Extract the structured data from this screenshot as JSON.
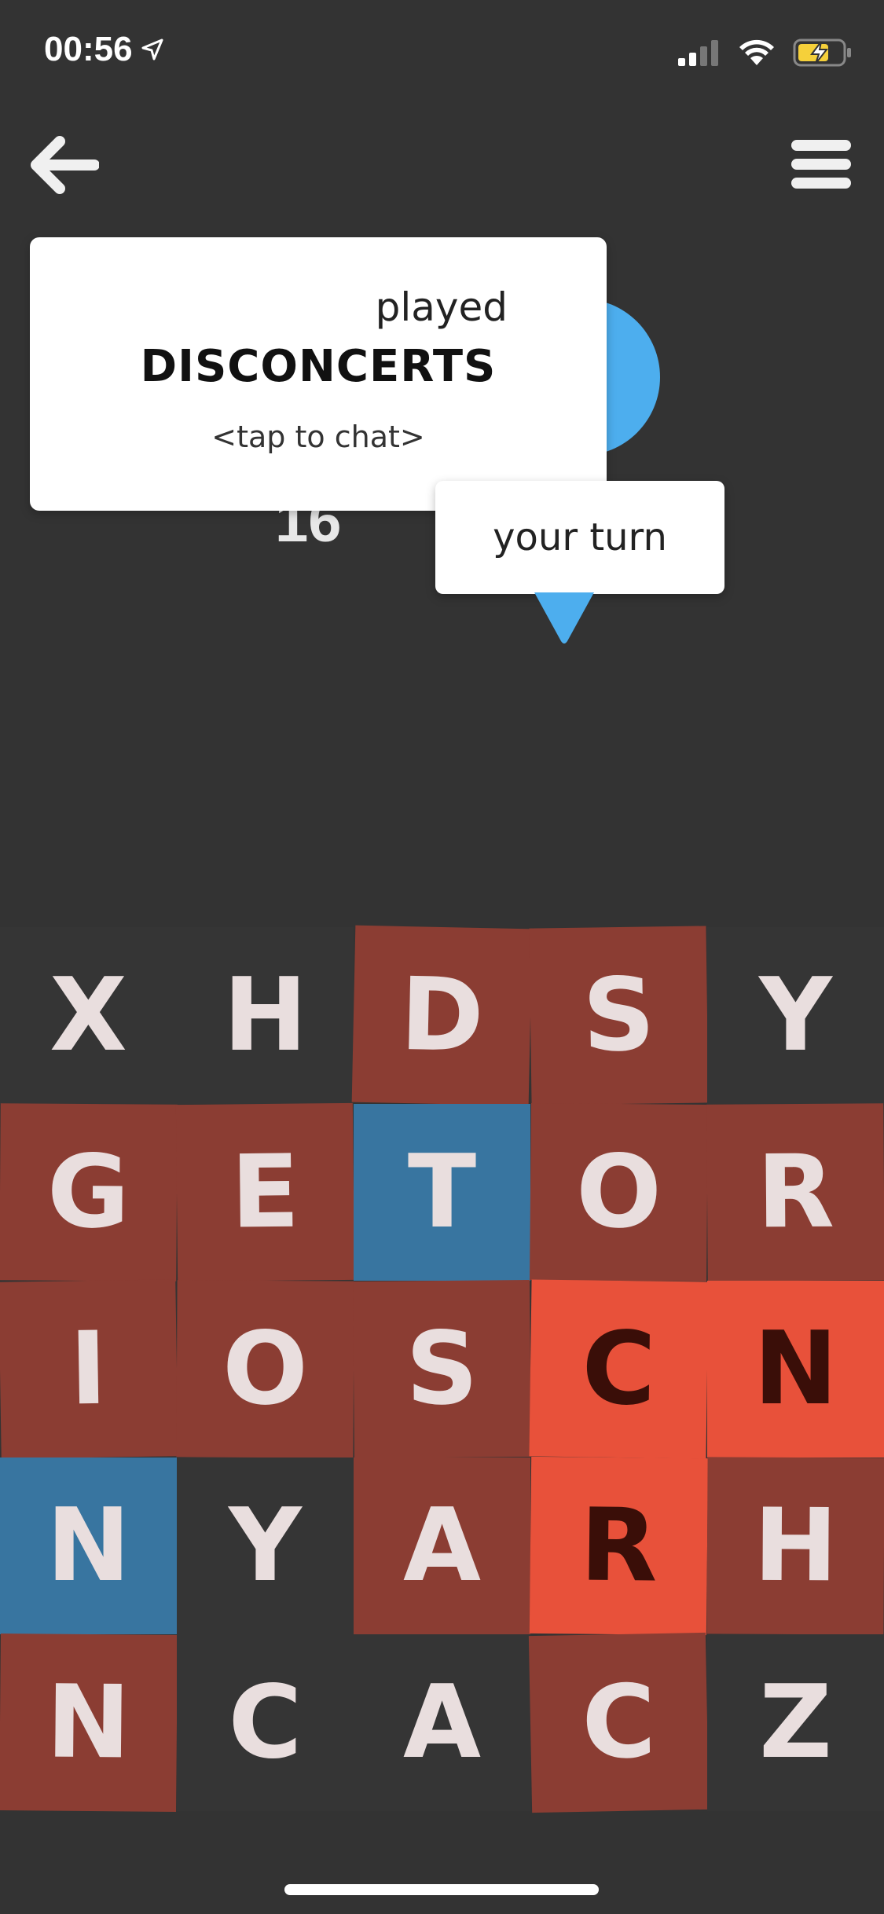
{
  "status_bar": {
    "time": "00:56",
    "location_icon": "location-arrow-icon",
    "signal_icon": "cellular-signal-icon",
    "wifi_icon": "wifi-icon",
    "battery_icon": "battery-charging-icon"
  },
  "nav": {
    "back_icon": "back-arrow-icon",
    "menu_icon": "hamburger-menu-icon"
  },
  "popup": {
    "played_label": "played",
    "word": "DISCONCERTS",
    "chat_hint": "<tap to chat>"
  },
  "score": "16",
  "turn": {
    "label": "your turn"
  },
  "colors": {
    "background": "#333333",
    "neutral_tile": "#353535",
    "red_dark": "#8B3D33",
    "red_bright": "#E8513A",
    "blue_dark": "#3875A0",
    "blue_bright": "#4DAEEE",
    "letter_light": "#E9DEDE",
    "letter_dark": "#3A0E08"
  },
  "board": {
    "rows": [
      [
        {
          "letter": "X",
          "owner": "neutral"
        },
        {
          "letter": "H",
          "owner": "neutral"
        },
        {
          "letter": "D",
          "owner": "red"
        },
        {
          "letter": "S",
          "owner": "red"
        },
        {
          "letter": "Y",
          "owner": "neutral"
        }
      ],
      [
        {
          "letter": "G",
          "owner": "red"
        },
        {
          "letter": "E",
          "owner": "red"
        },
        {
          "letter": "T",
          "owner": "blue"
        },
        {
          "letter": "O",
          "owner": "red"
        },
        {
          "letter": "R",
          "owner": "red"
        }
      ],
      [
        {
          "letter": "I",
          "owner": "red"
        },
        {
          "letter": "O",
          "owner": "red"
        },
        {
          "letter": "S",
          "owner": "red"
        },
        {
          "letter": "C",
          "owner": "red-locked"
        },
        {
          "letter": "N",
          "owner": "red-locked"
        }
      ],
      [
        {
          "letter": "N",
          "owner": "blue"
        },
        {
          "letter": "Y",
          "owner": "neutral"
        },
        {
          "letter": "A",
          "owner": "red"
        },
        {
          "letter": "R",
          "owner": "red-locked"
        },
        {
          "letter": "H",
          "owner": "red"
        }
      ],
      [
        {
          "letter": "N",
          "owner": "red"
        },
        {
          "letter": "C",
          "owner": "neutral"
        },
        {
          "letter": "A",
          "owner": "neutral"
        },
        {
          "letter": "C",
          "owner": "red"
        },
        {
          "letter": "Z",
          "owner": "neutral"
        }
      ]
    ]
  }
}
